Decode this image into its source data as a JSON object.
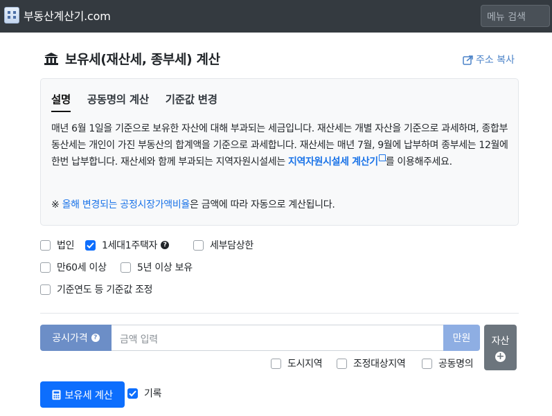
{
  "navbar": {
    "brand": "부동산계산기.com",
    "search_placeholder": "메뉴 검색"
  },
  "page": {
    "title": "보유세(재산세, 종부세) 계산",
    "share_label": "주소 복사"
  },
  "info": {
    "tabs": [
      {
        "label": "설명",
        "active": true
      },
      {
        "label": "공동명의 계산",
        "active": false
      },
      {
        "label": "기준값 변경",
        "active": false
      }
    ],
    "desc_text": "매년 6월 1일을 기준으로 보유한 자산에 대해 부과되는 세금입니다. 재산세는 개별 자산을 기준으로 과세하며, 종합부동산세는 개인이 가진 부동산의 합계액을 기준으로 과세합니다. 재산세는 매년 7월, 9월에 납부하며 종부세는 12월에 한번 납부합니다. 재산세와 함께 부과되는 지역자원시설세는 ",
    "desc_link": "지역자원시설세 계산기",
    "desc_suffix": "를 이용해주세요.",
    "note_prefix": "※ ",
    "note_link": "올해 변경되는 공정시장가액비율",
    "note_suffix": "은 금액에 따라 자동으로 계산됩니다."
  },
  "options": {
    "corporate": {
      "label": "법인",
      "checked": false
    },
    "one_house": {
      "label": "1세대1주택자",
      "checked": true
    },
    "joint_burden": {
      "label": "세부담상한",
      "checked": false
    },
    "age60": {
      "label": "만60세 이상",
      "checked": false
    },
    "hold5": {
      "label": "5년 이상 보유",
      "checked": false
    },
    "adjust_base": {
      "label": "기준연도 등 기준값 조정",
      "checked": false
    }
  },
  "price_input": {
    "label": "공시가격",
    "placeholder": "금액 입력",
    "unit": "만원",
    "sub_options": [
      {
        "label": "도시지역",
        "checked": false
      },
      {
        "label": "조정대상지역",
        "checked": false
      },
      {
        "label": "공동명의",
        "checked": false
      }
    ]
  },
  "asset_button": {
    "label": "자산",
    "plus": "+"
  },
  "calc_button": {
    "label": "보유세 계산"
  },
  "record": {
    "label": "기록",
    "checked": true
  },
  "colors": {
    "primary": "#0d6efd",
    "navbar": "#343a40",
    "label_bg": "#6c8ec7",
    "link": "#1a73e8"
  }
}
